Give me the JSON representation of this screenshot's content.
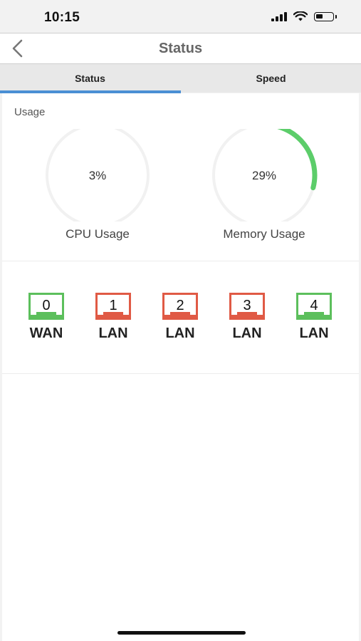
{
  "status_bar": {
    "time": "10:15"
  },
  "nav": {
    "title": "Status",
    "back_icon": "chevron-left-icon"
  },
  "tabs": [
    {
      "label": "Status",
      "active": true
    },
    {
      "label": "Speed",
      "active": false
    }
  ],
  "usage": {
    "section_label": "Usage",
    "cpu": {
      "value_text": "3%",
      "fraction": 0.03,
      "label": "CPU Usage",
      "color": "#e8e84a"
    },
    "memory": {
      "value_text": "29%",
      "fraction": 0.29,
      "label": "Memory Usage",
      "color": "#5ccd6a"
    }
  },
  "ports": [
    {
      "number": "0",
      "name": "WAN",
      "connected": true,
      "color": "#5cbf5c"
    },
    {
      "number": "1",
      "name": "LAN",
      "connected": false,
      "color": "#e05a45"
    },
    {
      "number": "2",
      "name": "LAN",
      "connected": false,
      "color": "#e05a45"
    },
    {
      "number": "3",
      "name": "LAN",
      "connected": false,
      "color": "#e05a45"
    },
    {
      "number": "4",
      "name": "LAN",
      "connected": true,
      "color": "#5cbf5c"
    }
  ]
}
